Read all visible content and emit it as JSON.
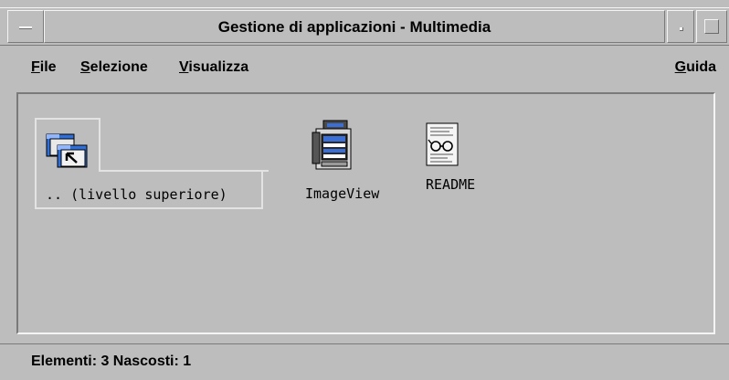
{
  "window": {
    "title": "Gestione di applicazioni -  Multimedia"
  },
  "menubar": {
    "file": {
      "mnemonic": "F",
      "rest": "ile"
    },
    "selezione": {
      "mnemonic": "S",
      "rest": "elezione"
    },
    "visualizza": {
      "mnemonic": "V",
      "rest": "isualizza"
    },
    "guida": {
      "mnemonic": "G",
      "rest": "uida"
    }
  },
  "items": [
    {
      "label": "..  (livello superiore)",
      "icon": "parent-folder-icon"
    },
    {
      "label": "ImageView",
      "icon": "image-viewer-icon"
    },
    {
      "label": "README",
      "icon": "readme-document-icon"
    }
  ],
  "status": {
    "text": "Elementi: 3 Nascosti: 1"
  }
}
